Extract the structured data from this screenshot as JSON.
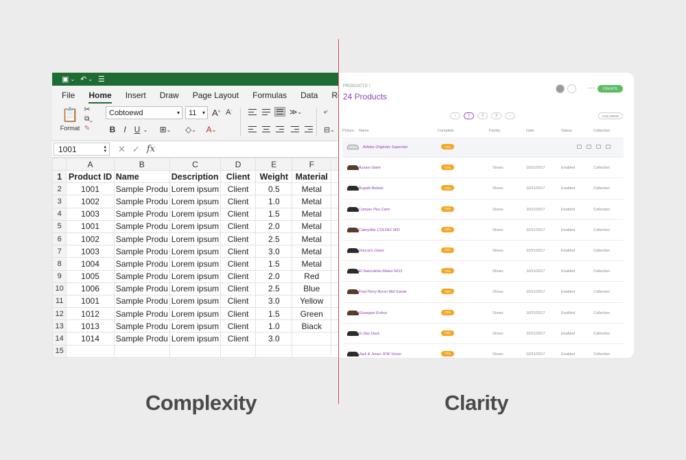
{
  "excel": {
    "menu": [
      "File",
      "Home",
      "Insert",
      "Draw",
      "Page Layout",
      "Formulas",
      "Data",
      "Review"
    ],
    "active_menu": "Home",
    "ribbon": {
      "format_label": "Format",
      "font_name": "Cobtoewd",
      "font_size": "11",
      "bold": "B",
      "italic": "I",
      "underline": "U"
    },
    "formula_bar": {
      "cell_ref": "1001",
      "fx": "fx"
    },
    "columns": [
      "A",
      "B",
      "C",
      "D",
      "E",
      "F"
    ],
    "rows": [
      {
        "n": "1",
        "cells": [
          "Product ID",
          "Name",
          "Description",
          "Client",
          "Weight",
          "Material"
        ]
      },
      {
        "n": "2",
        "cells": [
          "1001",
          "Sample Produ",
          "Lorem ipsum",
          "Client",
          "0.5",
          "Metal"
        ]
      },
      {
        "n": "3",
        "cells": [
          "1002",
          "Sample Produ",
          "Lorem ipsum",
          "Client",
          "1.0",
          "Metal"
        ]
      },
      {
        "n": "4",
        "cells": [
          "1003",
          "Sample Produ",
          "Lorem ipsum",
          "Client",
          "1.5",
          "Metal"
        ]
      },
      {
        "n": "5",
        "cells": [
          "1001",
          "Sample Produ",
          "Lorem ipsum",
          "Client",
          "2.0",
          "Metal"
        ]
      },
      {
        "n": "6",
        "cells": [
          "1002",
          "Sample Produ",
          "Lorem ipsum",
          "Client",
          "2.5",
          "Metal"
        ]
      },
      {
        "n": "7",
        "cells": [
          "1003",
          "Sample Produ",
          "Lorem ipsum",
          "Client",
          "3.0",
          "Metal"
        ]
      },
      {
        "n": "8",
        "cells": [
          "1004",
          "Sample Produ",
          "Lorem ipsum",
          "Client",
          "1.5",
          "Metal"
        ]
      },
      {
        "n": "9",
        "cells": [
          "1005",
          "Sample Produ",
          "Lorem ipsum",
          "Client",
          "2.0",
          "Red"
        ]
      },
      {
        "n": "10",
        "cells": [
          "1006",
          "Sample Produ",
          "Lorem ipsum",
          "Client",
          "2.5",
          "Blue"
        ]
      },
      {
        "n": "11",
        "cells": [
          "1001",
          "Sample Produ",
          "Lorem ipsum",
          "Client",
          "3.0",
          "Yellow"
        ]
      },
      {
        "n": "12",
        "cells": [
          "1012",
          "Sample Produ",
          "Lorem ipsum",
          "Client",
          "1.5",
          "Green"
        ]
      },
      {
        "n": "13",
        "cells": [
          "1013",
          "Sample Produ",
          "Lorem ipsum",
          "Client",
          "1.0",
          "Biack"
        ]
      },
      {
        "n": "14",
        "cells": [
          "1014",
          "Sample Produ",
          "Lorem ipsum",
          "Client",
          "3.0",
          ""
        ]
      },
      {
        "n": "15",
        "cells": [
          "",
          "",
          "",
          "",
          "",
          ""
        ]
      }
    ]
  },
  "products": {
    "breadcrumb": "PRODUCTS  /",
    "title": "24 Products",
    "create_label": "CREATE",
    "more_label": "···",
    "columns_label": "COLUMNS",
    "pages": [
      "‹",
      "1",
      "2",
      "3",
      "›"
    ],
    "active_page": "1",
    "headers": [
      "Picture",
      "Name",
      "Complete",
      "Family",
      "Date",
      "Status",
      "Collection"
    ],
    "rows": [
      {
        "name": "Adidas Originals Superstar",
        "complete": "70%",
        "family": "",
        "date": "",
        "status": "",
        "collection": "",
        "shoe": "light"
      },
      {
        "name": "Azzaro Giant",
        "complete": "70%",
        "family": "Shoes",
        "date": "10/21/2017",
        "status": "Enabled",
        "collection": "Collection",
        "shoe": "brown"
      },
      {
        "name": "Bugatti Bebele",
        "complete": "70%",
        "family": "Shoes",
        "date": "10/21/2017",
        "status": "Enabled",
        "collection": "Collection",
        "shoe": "dark"
      },
      {
        "name": "Camper Peu Cami",
        "complete": "70%",
        "family": "Shoes",
        "date": "10/21/2017",
        "status": "Enabled",
        "collection": "Collection",
        "shoe": "dark"
      },
      {
        "name": "Caterpillar COLFAX MID",
        "complete": "70%",
        "family": "Shoes",
        "date": "10/21/2017",
        "status": "Enabled",
        "collection": "Collection",
        "shoe": "brown"
      },
      {
        "name": "Doucal's Owen",
        "complete": "70%",
        "family": "Shoes",
        "date": "10/21/2017",
        "status": "Enabled",
        "collection": "Collection",
        "shoe": "dark"
      },
      {
        "name": "El Naturalista Meteo N211",
        "complete": "70%",
        "family": "Shoes",
        "date": "10/21/2017",
        "status": "Enabled",
        "collection": "Collection",
        "shoe": "dark"
      },
      {
        "name": "Fred Perry Byron Mid Suede",
        "complete": "70%",
        "family": "Shoes",
        "date": "10/21/2017",
        "status": "Enabled",
        "collection": "Collection",
        "shoe": "brown"
      },
      {
        "name": "Giuseppe Errbus",
        "complete": "70%",
        "family": "Shoes",
        "date": "10/21/2017",
        "status": "Enabled",
        "collection": "Collection",
        "shoe": "brown"
      },
      {
        "name": "G-Star Dock",
        "complete": "70%",
        "family": "Shoes",
        "date": "10/21/2017",
        "status": "Enabled",
        "collection": "Collection",
        "shoe": "dark"
      },
      {
        "name": "Jack & Jones JFW Vision",
        "complete": "70%",
        "family": "Shoes",
        "date": "10/21/2017",
        "status": "Enabled",
        "collection": "Collection",
        "shoe": "dark"
      }
    ]
  },
  "captions": {
    "left": "Complexity",
    "right": "Clarity"
  },
  "colors": {
    "excel_green": "#1e6b33",
    "accent_purple": "#8e3fb3",
    "badge_orange": "#f5a623",
    "create_green": "#5dbb63",
    "divider_red": "#e4473b"
  }
}
